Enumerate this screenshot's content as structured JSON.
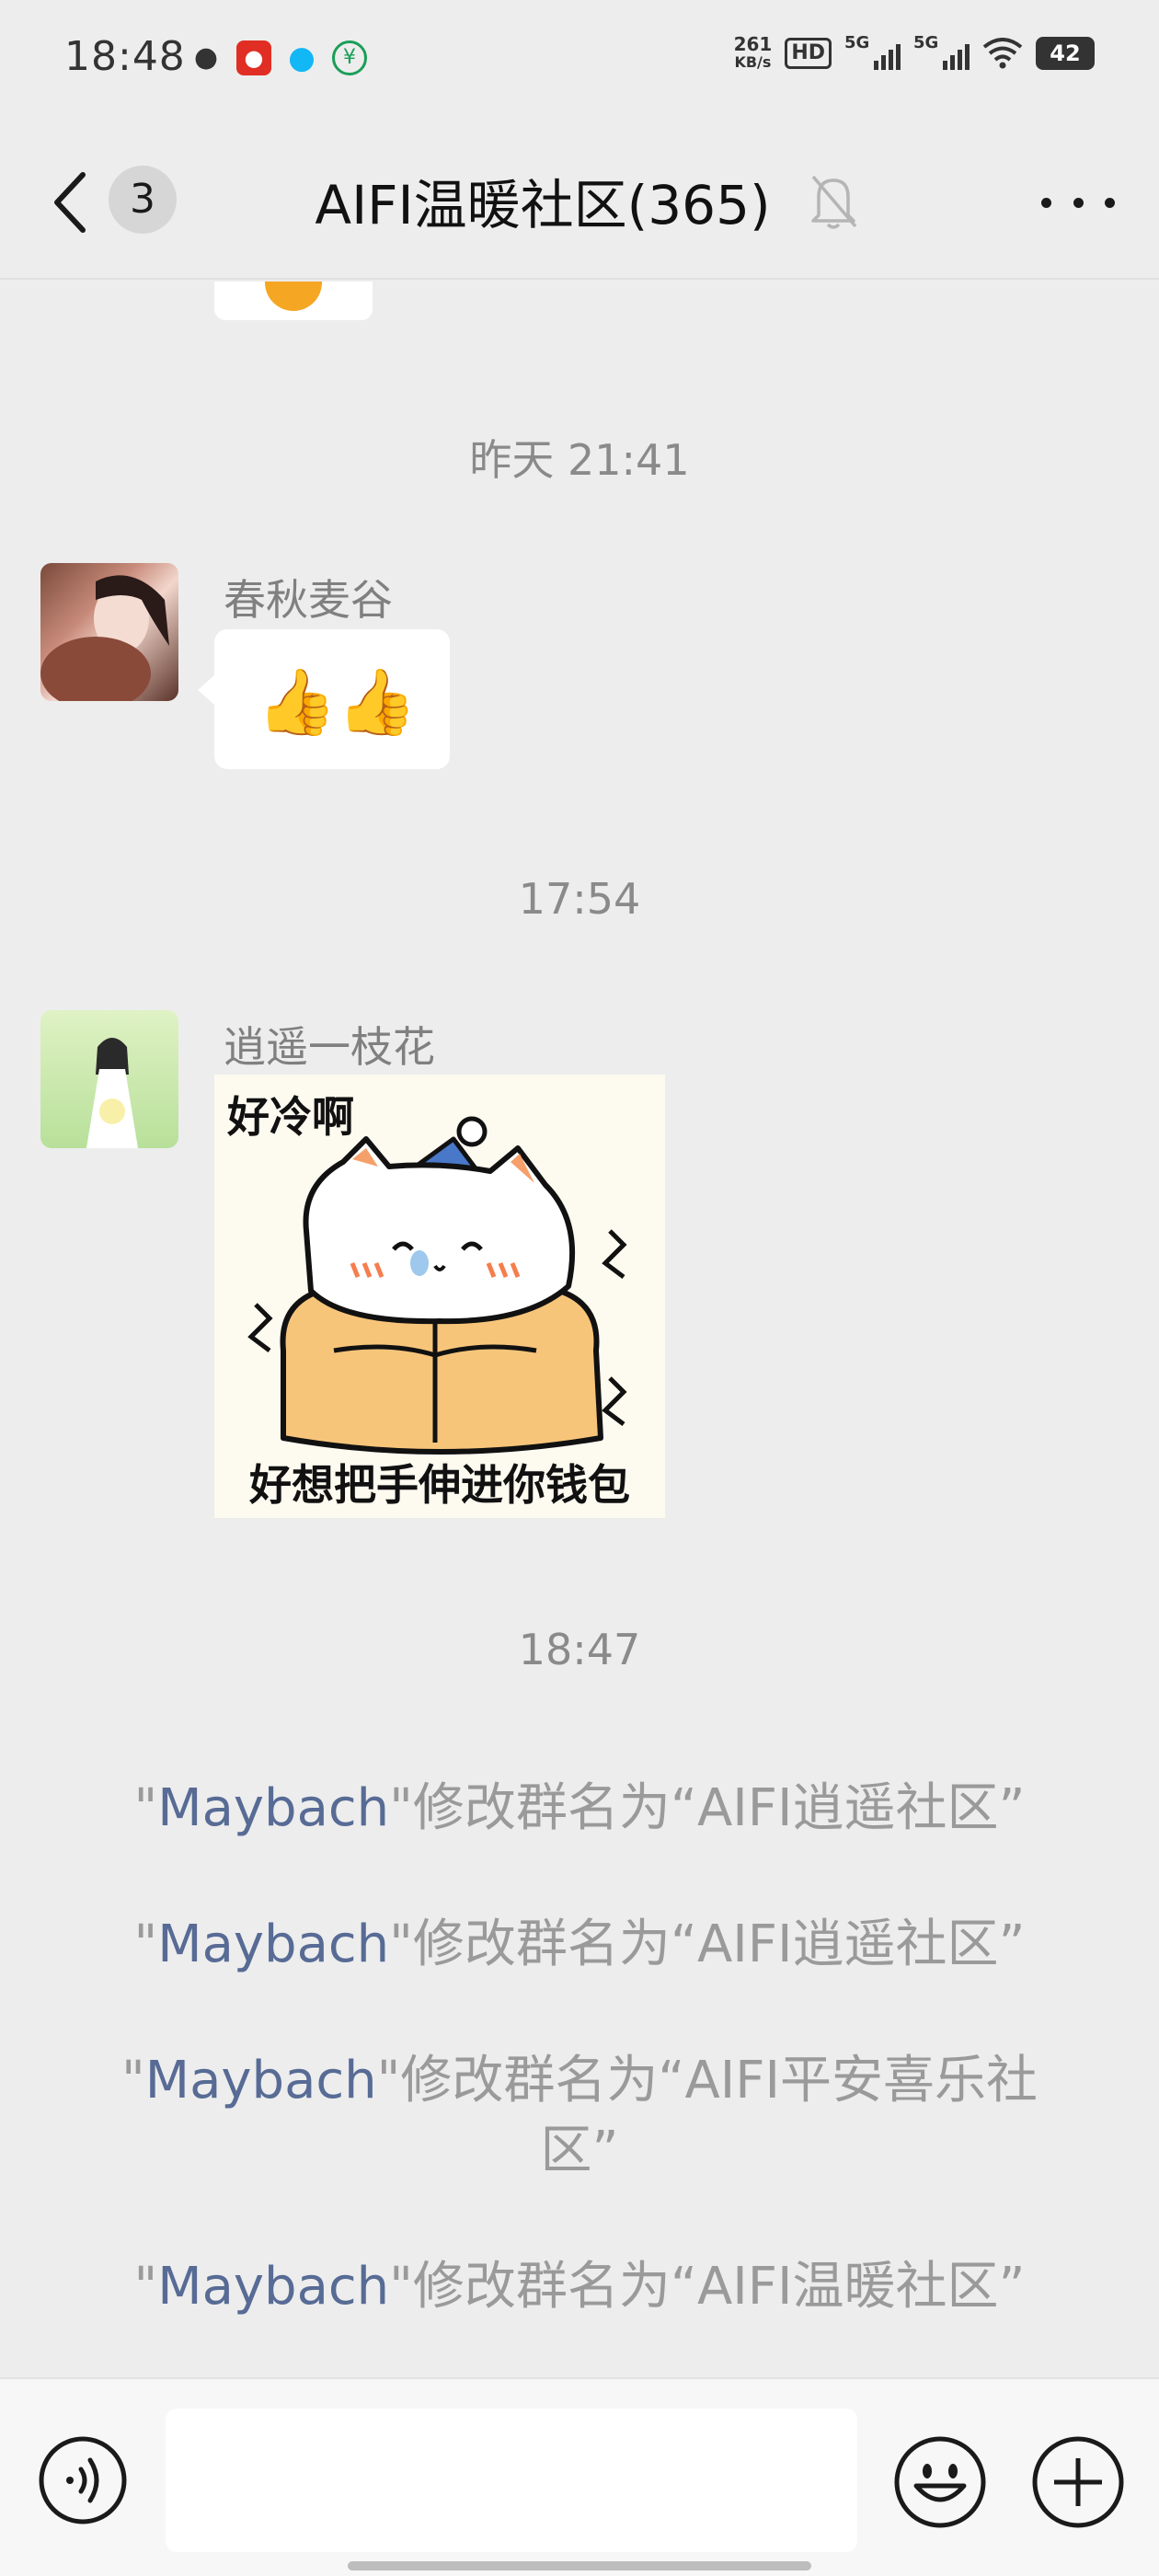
{
  "status_bar": {
    "time": "18:48",
    "net_rate_value": "261",
    "net_rate_unit": "KB/s",
    "hd_label": "HD",
    "signal_label_1": "5G",
    "signal_label_2": "5G",
    "battery": "42",
    "app_icons": [
      "wechat-icon",
      "pinduoduo-icon",
      "qq-icon",
      "bank-icon"
    ]
  },
  "nav": {
    "unread_count": "3",
    "title": "AIFI温暖社区(365)",
    "icons": [
      "back-chevron-icon",
      "mute-bell-icon",
      "more-dots-icon"
    ]
  },
  "chat": {
    "timestamps": [
      "昨天 21:41",
      "17:54",
      "18:47"
    ],
    "messages": [
      {
        "sender": "春秋麦谷",
        "content": "👍👍"
      },
      {
        "sender": "逍遥一枝花",
        "sticker_top": "好冷啊",
        "sticker_bottom": "好想把手伸进你钱包"
      }
    ],
    "system_messages": [
      {
        "prefix": "\"",
        "name": "Maybach",
        "text": "\"修改群名为“AIFI逍遥社区”"
      },
      {
        "prefix": "\"",
        "name": "Maybach",
        "text": "\"修改群名为“AIFI逍遥社区”"
      },
      {
        "prefix": "\"",
        "name": "Maybach",
        "text": "\"修改群名为“AIFI平安喜乐社区”"
      },
      {
        "prefix": "\"",
        "name": "Maybach",
        "text": "\"修改群名为“AIFI温暖社区”"
      }
    ]
  },
  "input_bar": {
    "placeholder": "",
    "icons": [
      "voice-icon",
      "emoji-icon",
      "plus-icon"
    ]
  },
  "colors": {
    "background": "#ededed",
    "bubble": "#ffffff",
    "link_name": "#576b95",
    "system_text": "#9a9a9a"
  }
}
